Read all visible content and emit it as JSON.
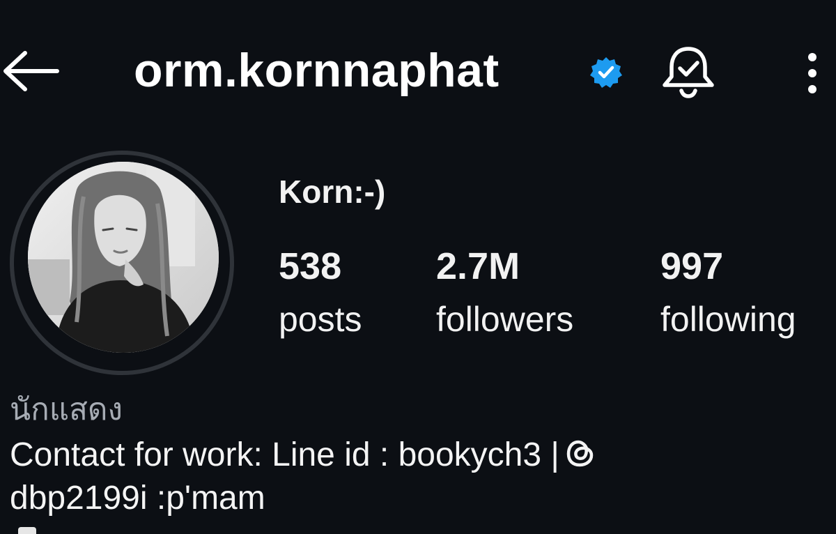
{
  "header": {
    "back_icon": "arrow-left-icon",
    "username": "orm.kornnaphat",
    "verified_icon": "verified-badge-icon",
    "verified_color": "#1d9bf0",
    "notification_icon": "bell-check-icon",
    "more_icon": "more-vertical-icon"
  },
  "profile": {
    "display_name": "Korn:-)",
    "stats": {
      "posts_value": "538",
      "posts_label": "posts",
      "followers_value": "2.7M",
      "followers_label": "followers",
      "following_value": "997",
      "following_label": "following"
    },
    "category": "นักแสดง",
    "bio_line1": "Contact for work: Line id : bookych3 |",
    "bio_line2": "dbp2199i :p'mam",
    "threads_icon": "threads-icon"
  },
  "colors": {
    "background": "#0c0f14",
    "text": "#f2f2f2",
    "muted_text": "#a7acb4",
    "avatar_ring": "#2f3339"
  }
}
